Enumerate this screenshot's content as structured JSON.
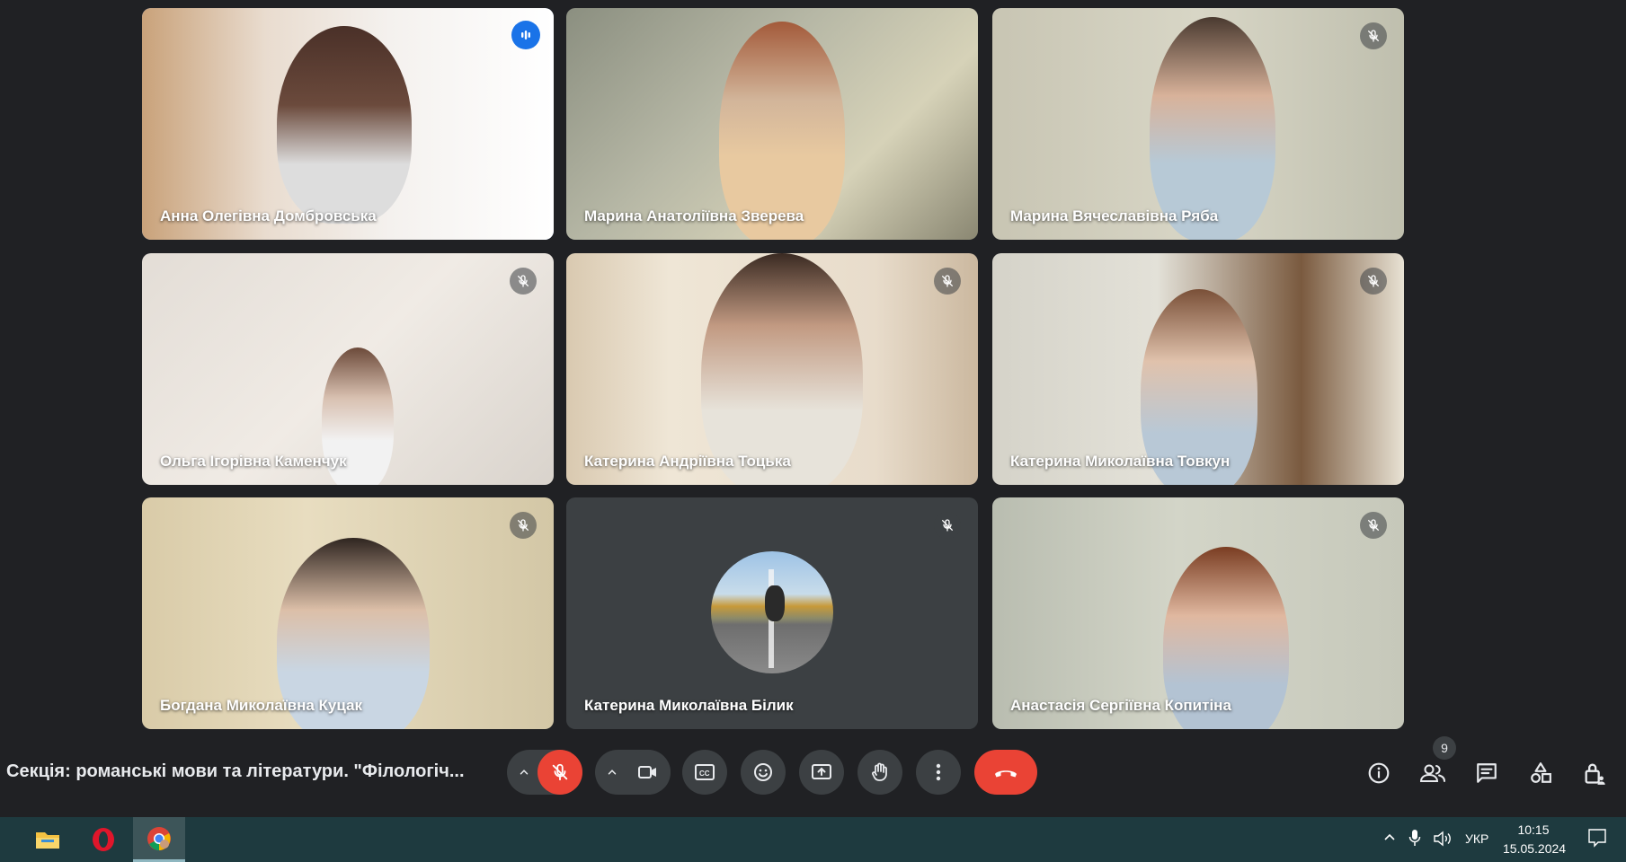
{
  "participants": [
    {
      "name": "Анна Олегівна Домбровська",
      "state": "speaking"
    },
    {
      "name": "Марина Анатоліївна Зверева",
      "state": "unmuted"
    },
    {
      "name": "Марина Вячеславівна Ряба",
      "state": "muted"
    },
    {
      "name": "Ольга Ігорівна Каменчук",
      "state": "muted"
    },
    {
      "name": "Катерина Андріївна Тоцька",
      "state": "muted"
    },
    {
      "name": "Катерина Миколаївна Товкун",
      "state": "muted"
    },
    {
      "name": "Богдана Миколаївна Куцак",
      "state": "muted"
    },
    {
      "name": "Катерина Миколаївна Білик",
      "state": "muted",
      "camera": "off"
    },
    {
      "name": "Анастасія Сергіївна Копитіна",
      "state": "muted"
    }
  ],
  "meeting": {
    "title": "Секція: романські мови та літератури. \"Філологіч...",
    "participant_count": "9"
  },
  "controls": [
    "mic-options",
    "microphone-muted",
    "camera-options",
    "camera",
    "captions",
    "reactions",
    "present-screen",
    "raise-hand",
    "more-options",
    "leave-call"
  ],
  "side_controls": [
    "meeting-info",
    "people",
    "chat",
    "activities",
    "host-controls"
  ],
  "taskbar": {
    "apps": [
      "file-explorer",
      "opera",
      "chrome"
    ],
    "language": "УКР",
    "time": "10:15",
    "date": "15.05.2024"
  },
  "colors": {
    "background": "#202124",
    "active_border": "#8ab4f8",
    "leave_red": "#ea4335",
    "taskbar": "#1e3a3f"
  }
}
